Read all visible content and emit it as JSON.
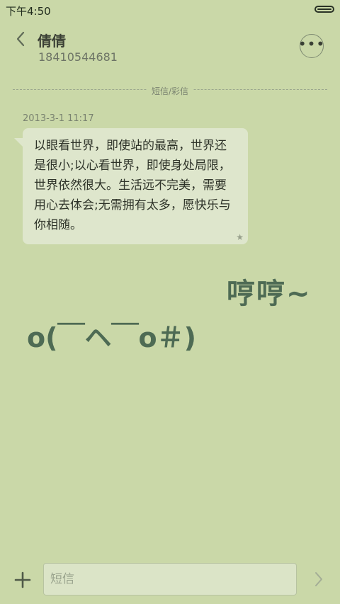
{
  "status_bar": {
    "time": "下午4:50",
    "battery_level": 1.0
  },
  "header": {
    "contact_name": "倩倩",
    "contact_phone": "18410544681"
  },
  "thread": {
    "channel_label": "短信/彩信",
    "messages": [
      {
        "timestamp": "2013-3-1 11:17",
        "text": "以眼看世界，即使站的最高，世界还是很小;以心看世界，即使身处局限，世界依然很大。生活远不完美，需要用心去体会;无需拥有太多，愿快乐与你相随。",
        "starred": true
      }
    ],
    "sticker": {
      "line1": "哼哼~",
      "line2": "o(￣ヘ￣o＃)"
    }
  },
  "composer": {
    "placeholder": "短信"
  },
  "icons": {
    "back": "chevron-left-icon",
    "more": "more-dots-icon",
    "plus": "plus-icon",
    "send": "chevron-right-icon",
    "star": "star-icon"
  }
}
